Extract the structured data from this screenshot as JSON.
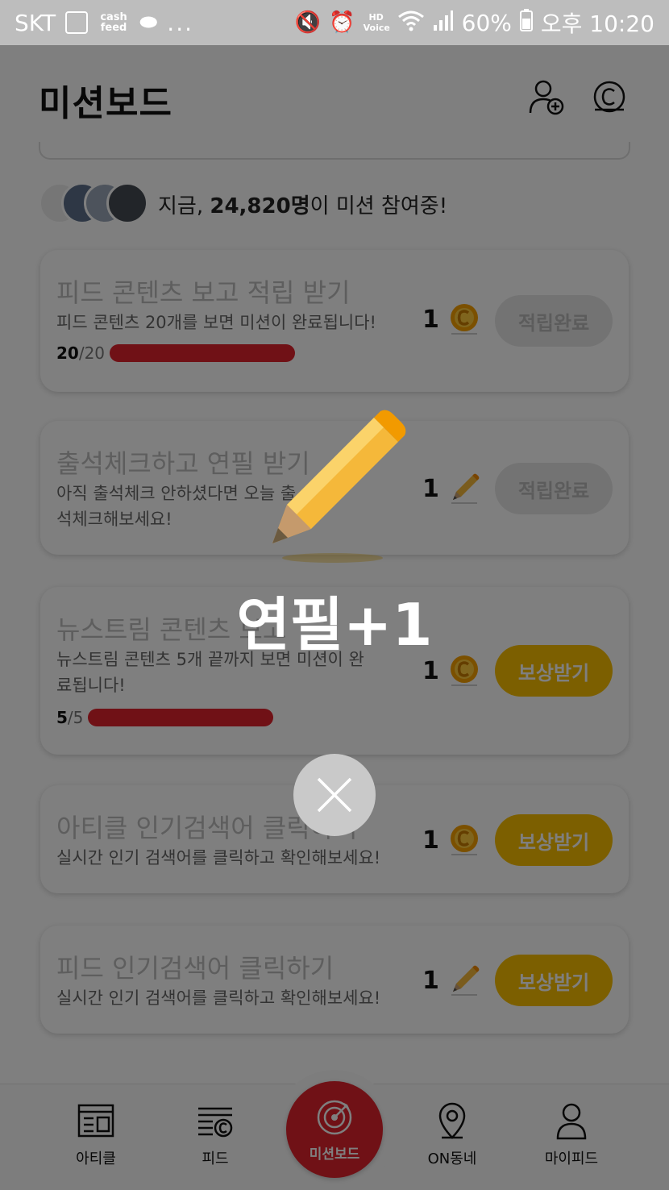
{
  "status_bar": {
    "carrier": "SKT",
    "cash_feed": "cash feed",
    "more": "...",
    "hd_voice": "HD Voice",
    "battery": "60%",
    "time": "오후 10:20"
  },
  "header": {
    "title": "미션보드"
  },
  "participants": {
    "prefix": "지금, ",
    "count": "24,820명",
    "suffix": "이 미션 참여중!"
  },
  "missions": [
    {
      "title": "피드 콘텐츠 보고 적립 받기",
      "desc": "피드 콘텐츠 20개를 보면 미션이 완료됩니다!",
      "progress_current": "20",
      "progress_total": "/20",
      "progress": 1.0,
      "reward_amount": "1",
      "reward_icon": "coin-icon",
      "button_label": "적립완료",
      "button_state": "done"
    },
    {
      "title": "출석체크하고 연필 받기",
      "desc": "아직 출석체크 안하셨다면 오늘 출석체크해보세요!",
      "reward_amount": "1",
      "reward_icon": "pencil-icon",
      "button_label": "적립완료",
      "button_state": "done"
    },
    {
      "title": "뉴스트림 콘텐츠 보고",
      "desc": "뉴스트림 콘텐츠 5개 끝까지 보면 미션이 완료됩니다!",
      "progress_current": "5",
      "progress_total": "/5",
      "progress": 1.0,
      "reward_amount": "1",
      "reward_icon": "coin-icon",
      "button_label": "보상받기",
      "button_state": "claim"
    },
    {
      "title": "아티클 인기검색어 클릭하기",
      "desc": "실시간 인기 검색어를 클릭하고 확인해보세요!",
      "reward_amount": "1",
      "reward_icon": "coin-icon",
      "button_label": "보상받기",
      "button_state": "claim"
    },
    {
      "title": "피드 인기검색어 클릭하기",
      "desc": "실시간 인기 검색어를 클릭하고 확인해보세요!",
      "reward_amount": "1",
      "reward_icon": "pencil-icon",
      "button_label": "보상받기",
      "button_state": "claim"
    }
  ],
  "bottom_nav": {
    "items": [
      {
        "label": "아티클",
        "icon": "article-icon"
      },
      {
        "label": "피드",
        "icon": "feed-icon"
      },
      {
        "label": "미션보드",
        "icon": "target-icon"
      },
      {
        "label": "ON동네",
        "icon": "map-pin-icon"
      },
      {
        "label": "마이피드",
        "icon": "person-icon"
      }
    ],
    "active": "미션보드"
  },
  "popup": {
    "text": "연필+1",
    "icon": "pencil-icon"
  },
  "colors": {
    "accent_red": "#e0222c",
    "claim_yellow": "#f8bf00",
    "coin_orange": "#f6a100",
    "pencil_yellow": "#f5b83a"
  }
}
